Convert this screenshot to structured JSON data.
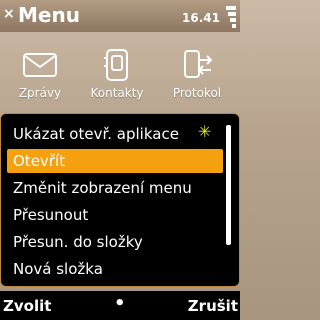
{
  "header": {
    "close_glyph": "×",
    "title": "Menu",
    "time": "16.41"
  },
  "apps": [
    {
      "label": "Zprávy",
      "icon": "envelope-icon"
    },
    {
      "label": "Kontakty",
      "icon": "contacts-icon"
    },
    {
      "label": "Protokol",
      "icon": "log-icon"
    }
  ],
  "menu": {
    "items": [
      {
        "label": "Ukázat otevř. aplikace",
        "selected": false
      },
      {
        "label": "Otevřít",
        "selected": true
      },
      {
        "label": "Změnit zobrazení menu",
        "selected": false
      },
      {
        "label": "Přesunout",
        "selected": false
      },
      {
        "label": "Přesun. do složky",
        "selected": false
      },
      {
        "label": "Nová složka",
        "selected": false
      }
    ],
    "sparkle_glyph": "✳"
  },
  "softkeys": {
    "left": "Zvolit",
    "middle": "•",
    "right": "Zrušit"
  },
  "colors": {
    "accent": "#f5a00f",
    "menu_border": "#ba8a45",
    "menu_bg": "#000000"
  }
}
